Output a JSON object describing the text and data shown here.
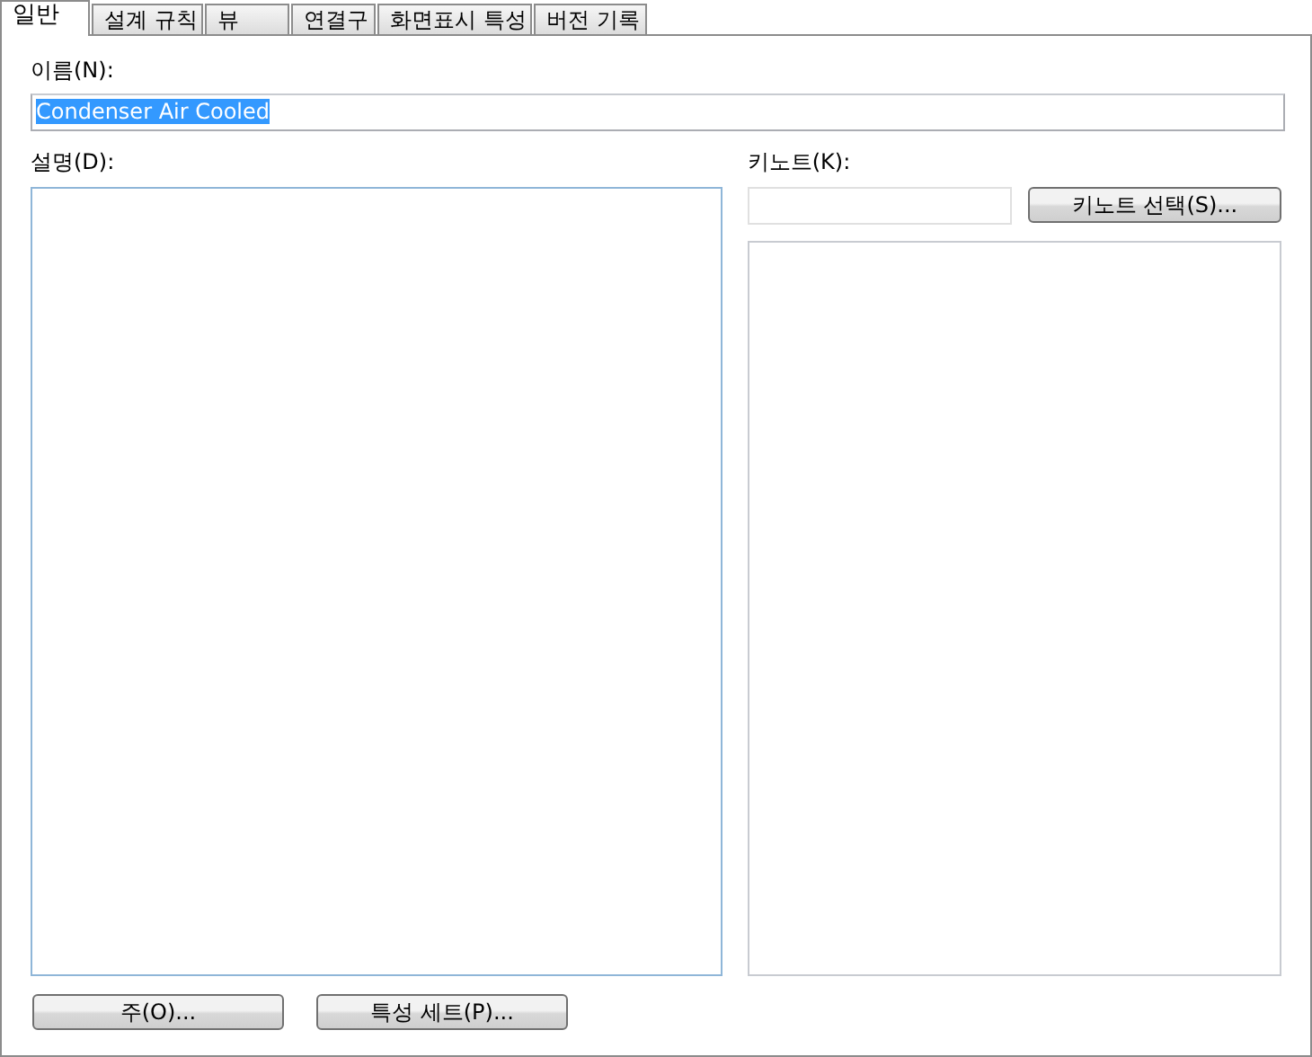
{
  "tabs": [
    {
      "label": "일반",
      "selected": true
    },
    {
      "label": "설계 규칙",
      "selected": false
    },
    {
      "label": "뷰",
      "selected": false
    },
    {
      "label": "연결구",
      "selected": false
    },
    {
      "label": "화면표시 특성",
      "selected": false
    },
    {
      "label": "버전 기록",
      "selected": false
    }
  ],
  "name": {
    "label": "이름(N):",
    "value": "Condenser Air Cooled",
    "highlighted": true
  },
  "description": {
    "label": "설명(D):"
  },
  "keynote": {
    "label": "키노트(K):",
    "button": "키노트 선택(S)..."
  },
  "buttons": [
    "주(O)...",
    "특성 세트(P)..."
  ]
}
